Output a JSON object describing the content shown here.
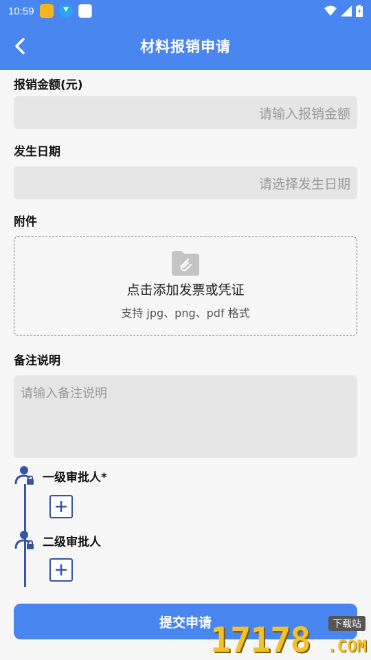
{
  "statusbar": {
    "time": "10:59"
  },
  "header": {
    "title": "材料报销申请"
  },
  "form": {
    "amount_label": "报销金额(元)",
    "amount_placeholder": "请输入报销金额",
    "date_label": "发生日期",
    "date_placeholder": "请选择发生日期",
    "attachment_label": "附件",
    "attachment_title": "点击添加发票或凭证",
    "attachment_subtitle": "支持 jpg、png、pdf 格式",
    "remark_label": "备注说明",
    "remark_placeholder": "请输入备注说明"
  },
  "approvers": [
    {
      "name": "一级审批人*"
    },
    {
      "name": "二级审批人"
    }
  ],
  "submit_label": "提交申请",
  "watermark": {
    "big": "17178",
    "dl": "下载站",
    "com": ".COM"
  },
  "colors": {
    "primary": "#4a86f0",
    "accent": "#3554a8",
    "field_bg": "#e6e6e6"
  }
}
